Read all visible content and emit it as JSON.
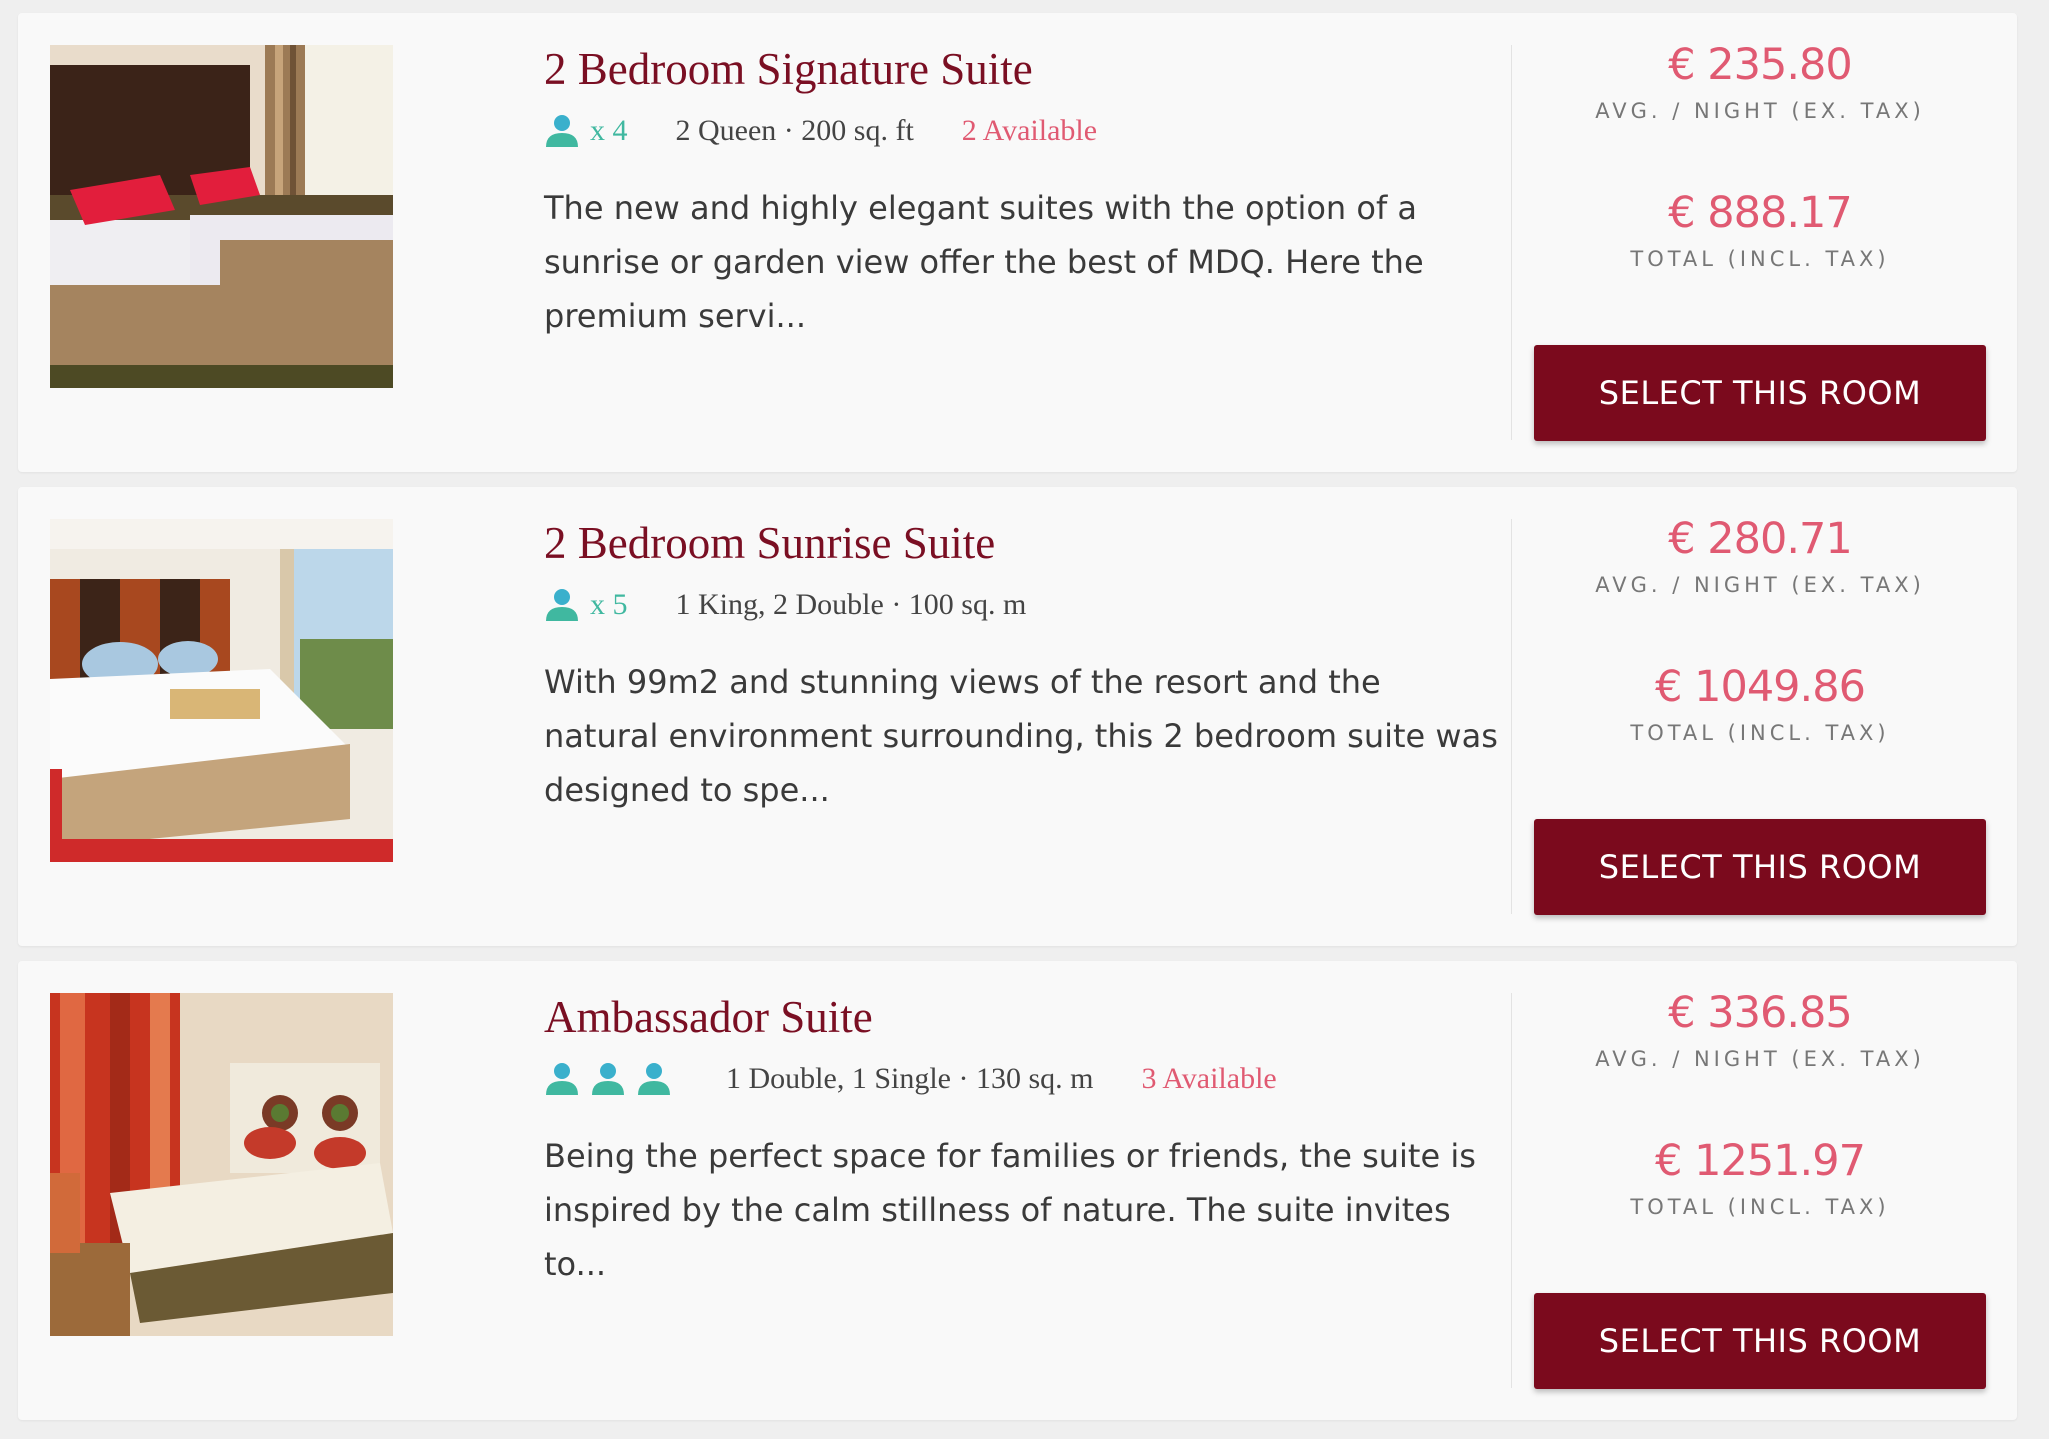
{
  "icons": {
    "guest": "person-icon"
  },
  "colors": {
    "title": "#7a0f23",
    "price": "#e05a72",
    "button": "#7b0a1d",
    "guest_icon": "#40b8a0"
  },
  "rooms": [
    {
      "title": "2 Bedroom Signature Suite",
      "guests": "x 4",
      "beds": "2 Queen · 200 sq. ft",
      "availability": "2 Available",
      "description": "The new and highly elegant suites with the option of a sunrise or garden view offer the best of MDQ. Here the premium servi...",
      "avg_price": "€ 235.80",
      "avg_label": "AVG. / NIGHT (EX. TAX)",
      "total_price": "€ 888.17",
      "total_label": "TOTAL (INCL. TAX)",
      "button": "SELECT THIS ROOM"
    },
    {
      "title": "2 Bedroom Sunrise Suite",
      "guests": "x 5",
      "beds": "1 King, 2 Double · 100 sq. m",
      "availability": "",
      "description": "With 99m2 and stunning views of the resort and the natural environment surrounding, this 2 bedroom suite was designed to spe...",
      "avg_price": "€ 280.71",
      "avg_label": "AVG. / NIGHT (EX. TAX)",
      "total_price": "€ 1049.86",
      "total_label": "TOTAL (INCL. TAX)",
      "button": "SELECT THIS ROOM"
    },
    {
      "title": "Ambassador Suite",
      "guests": "",
      "beds": "1 Double, 1 Single · 130 sq. m",
      "availability": "3 Available",
      "description": "Being the perfect space for families or friends, the suite is inspired by the calm stillness of nature. The suite invites to...",
      "avg_price": "€ 336.85",
      "avg_label": "AVG. / NIGHT (EX. TAX)",
      "total_price": "€ 1251.97",
      "total_label": "TOTAL (INCL. TAX)",
      "button": "SELECT THIS ROOM"
    }
  ]
}
